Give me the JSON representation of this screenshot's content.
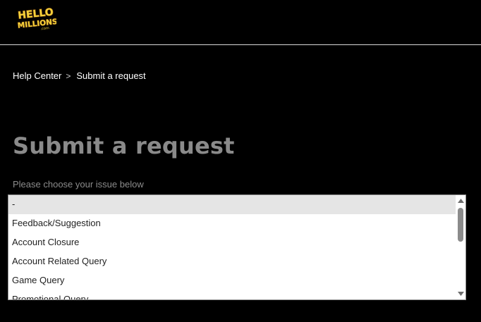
{
  "header": {
    "logo_text_line1": "HELLO",
    "logo_text_line2": "MILLIONS",
    "logo_text_line3": ".com"
  },
  "breadcrumb": {
    "items": [
      {
        "label": "Help Center"
      },
      {
        "label": "Submit a request"
      }
    ],
    "separator": ">"
  },
  "main": {
    "title": "Submit a request",
    "issue_label": "Please choose your issue below",
    "issue_select": {
      "selected": "-",
      "options": [
        "-",
        "Feedback/Suggestion",
        "Account Closure",
        "Account Related Query",
        "Game Query",
        "Promotional Query"
      ]
    }
  },
  "colors": {
    "background": "#000000",
    "title": "#8a8a8a",
    "logo_fill": "#f6d23a",
    "logo_stroke": "#7a4a12"
  }
}
